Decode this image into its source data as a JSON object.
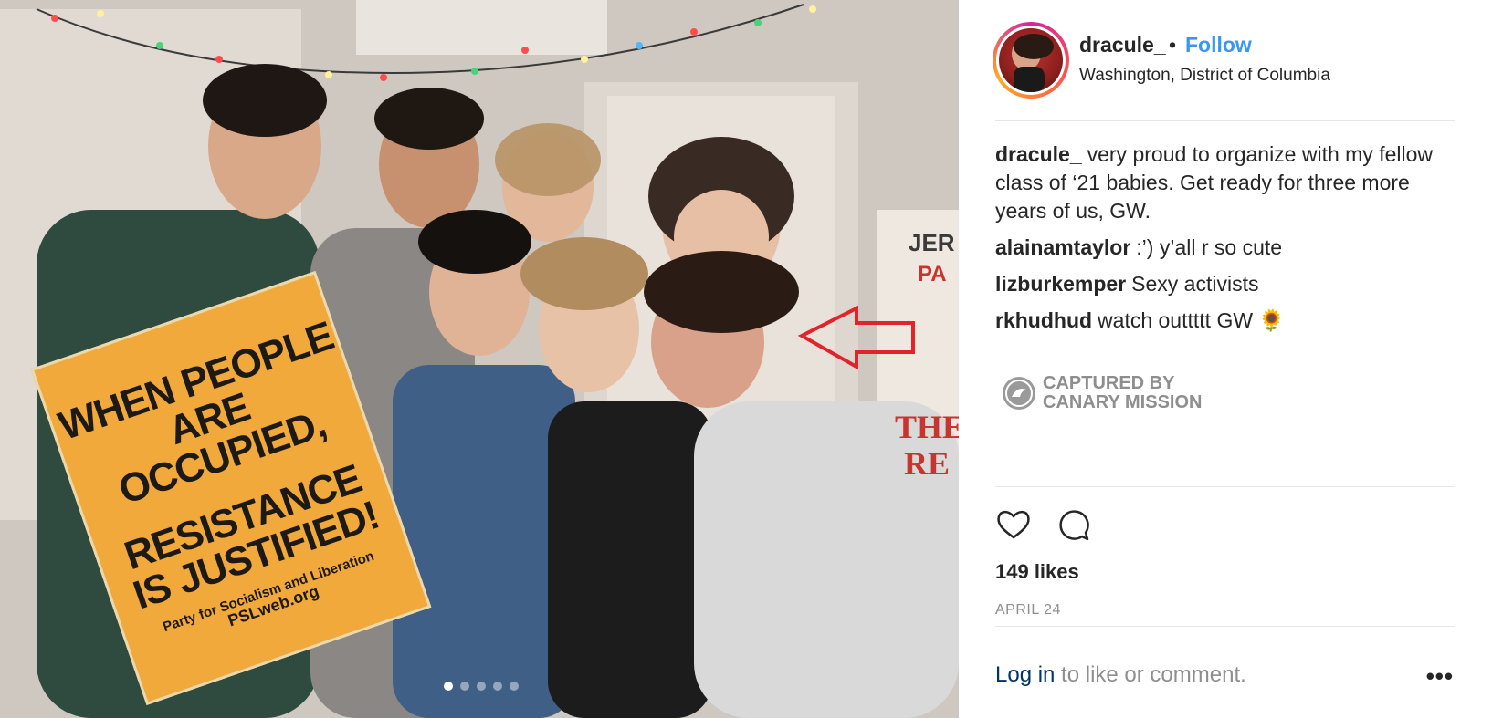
{
  "post": {
    "photo": {
      "sign": {
        "line1": "WHEN PEOPLE ARE OCCUPIED,",
        "line2": "RESISTANCE IS JUSTIFIED!",
        "line3": "Party for Socialism and Liberation",
        "line4": "PSLweb.org"
      },
      "carousel": {
        "count": 5,
        "active": 1
      }
    },
    "header": {
      "username": "dracule_",
      "separator": "•",
      "follow_label": "Follow",
      "location": "Washington, District of Columbia"
    },
    "comments": [
      {
        "user": "dracule_",
        "text": "very proud to organize with my fellow class of ‘21 babies. Get ready for three more years of us, GW."
      },
      {
        "user": "alainamtaylor",
        "text": ":’) y’all r so cute"
      },
      {
        "user": "lizburkemper",
        "text": "Sexy activists"
      },
      {
        "user": "rkhudhud",
        "text": "watch outtttt GW 🌻"
      }
    ],
    "watermark": {
      "line1": "CAPTURED BY",
      "line2": "CANARY MISSION"
    },
    "likes": "149 likes",
    "date": "APRIL 24",
    "footer": {
      "login_link": "Log in",
      "login_rest": " to like or comment.",
      "more": "•••"
    },
    "colors": {
      "link_blue": "#3897f0",
      "text": "#262626",
      "muted": "#8e8e8e",
      "sign_orange": "#f2a93b",
      "arrow_red": "#e0242a"
    }
  }
}
